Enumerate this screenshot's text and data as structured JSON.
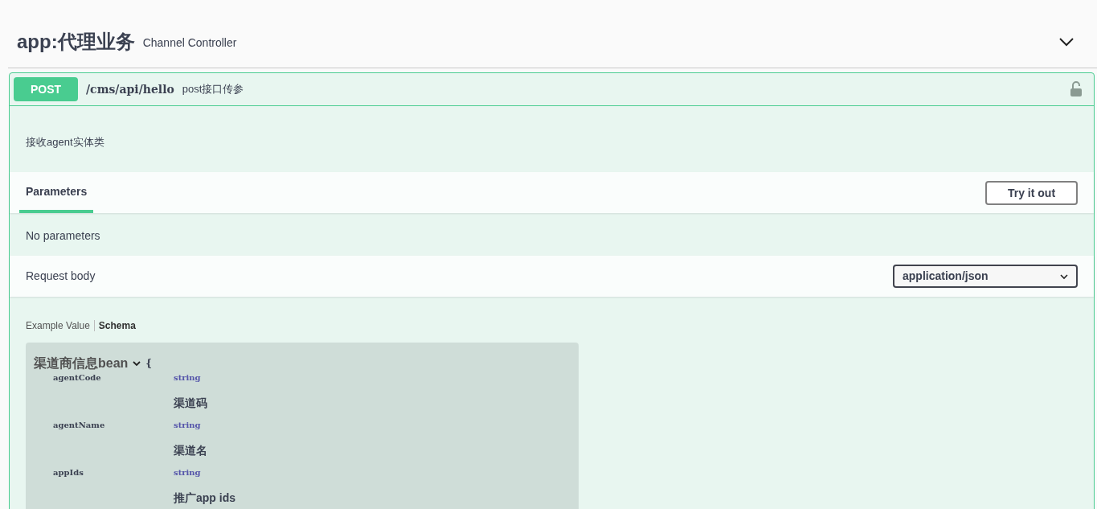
{
  "tag": {
    "name": "app:代理业务",
    "description": "Channel Controller",
    "expanded": true
  },
  "operation": {
    "method": "POST",
    "path": "/cms/api/hello",
    "summary": "post接口传参",
    "locked": false,
    "description": "接收agent实体类",
    "tabs": [
      {
        "label": "Parameters",
        "selected": true
      }
    ],
    "try_button": "Try it out",
    "parameters_text": "No parameters",
    "request_body": {
      "label": "Request body",
      "content_type": "application/json"
    },
    "model_tabs": [
      {
        "label": "Example Value",
        "selected": false
      },
      {
        "label": "Schema",
        "selected": true
      }
    ],
    "model": {
      "title": "渠道商信息bean",
      "expanded": true,
      "brace": "{",
      "properties": [
        {
          "name": "agentCode",
          "type": "string",
          "description": "渠道码"
        },
        {
          "name": "agentName",
          "type": "string",
          "description": "渠道名"
        },
        {
          "name": "appIds",
          "type": "string",
          "description": "推广app ids"
        }
      ]
    }
  }
}
